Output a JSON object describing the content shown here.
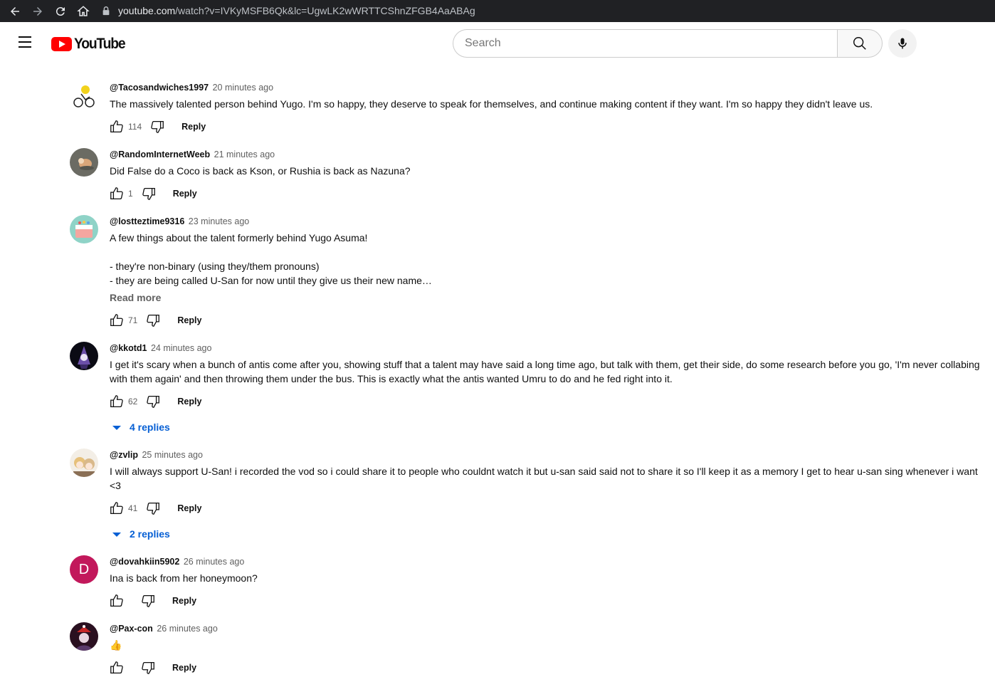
{
  "browser": {
    "url_host": "youtube.com",
    "url_path": "/watch?v=IVKyMSFB6Qk&lc=UgwLK2wWRTTCShnZFGB4AaABAg"
  },
  "header": {
    "logo_text": "YouTube",
    "search_placeholder": "Search"
  },
  "comments": [
    {
      "author": "@Tacosandwiches1997",
      "time": "20 minutes ago",
      "text": "The massively talented person behind Yugo. I'm so happy, they deserve to speak for themselves, and continue making content if they want. I'm so happy they didn't leave us.",
      "likes": "114",
      "reply_label": "Reply"
    },
    {
      "author": "@RandomInternetWeeb",
      "time": "21 minutes ago",
      "text": "Did False do a Coco is back as Kson, or Rushia is back as Nazuna?",
      "likes": "1",
      "reply_label": "Reply"
    },
    {
      "author": "@lostteztime9316",
      "time": "23 minutes ago",
      "text": "A few things about the talent formerly behind Yugo Asuma!\n\n- they're non-binary (using they/them pronouns)\n- they are being called U-San for now until they give us their new name…",
      "read_more": "Read more",
      "likes": "71",
      "reply_label": "Reply"
    },
    {
      "author": "@kkotd1",
      "time": "24 minutes ago",
      "text": "I get it's scary when a bunch of antis come after you, showing stuff that a talent may have said a long time ago, but talk with them, get their side, do some research before you go, 'I'm never collabing with them again' and then throwing them under the bus. This is exactly what the antis wanted Umru to do and he fed right into it.",
      "likes": "62",
      "reply_label": "Reply",
      "replies_label": "4 replies"
    },
    {
      "author": "@zvlip",
      "time": "25 minutes ago",
      "text": "I will always support U-San! i recorded the vod so i could share it to people who couldnt watch it but u-san said said not to share it so I'll keep it as a memory I get to hear u-san sing whenever i want <3",
      "likes": "41",
      "reply_label": "Reply",
      "replies_label": "2 replies"
    },
    {
      "author": "@dovahkiin5902",
      "time": "26 minutes ago",
      "text": "Ina is back from her honeymoon?",
      "likes": "",
      "reply_label": "Reply",
      "avatar_letter": "D"
    },
    {
      "author": "@Pax-con",
      "time": "26 minutes ago",
      "text": "👍",
      "likes": "",
      "reply_label": "Reply"
    }
  ],
  "colors": {
    "browser_bar": "#202124",
    "youtube_red": "#ff0000",
    "link_blue": "#065fd4",
    "secondary_text": "#606060",
    "avatar_d": "#c2185b"
  },
  "icons": [
    "back-icon",
    "forward-icon",
    "reload-icon",
    "home-icon",
    "lock-icon",
    "menu-icon",
    "search-icon",
    "mic-icon",
    "thumbs-up-icon",
    "thumbs-down-icon",
    "caret-down-icon"
  ]
}
